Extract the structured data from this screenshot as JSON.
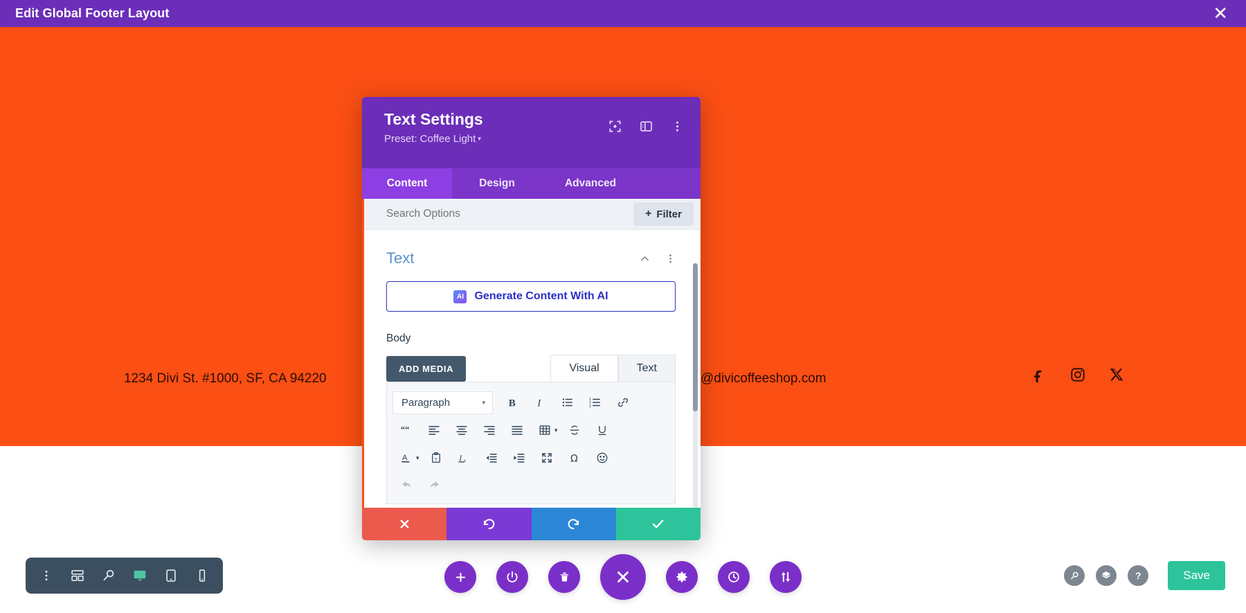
{
  "topbar": {
    "title": "Edit Global Footer Layout",
    "close_icon": "close-icon",
    "close_glyph": "✕",
    "background": "#6c2eb9"
  },
  "footer": {
    "background": "#fb4f14",
    "address": "1234 Divi St. #1000, SF, CA 94220",
    "email": "@divicoffeeshop.com",
    "social": [
      {
        "name": "facebook-icon",
        "label": "Facebook"
      },
      {
        "name": "instagram-icon",
        "label": "Instagram"
      },
      {
        "name": "x-twitter-icon",
        "label": "X"
      }
    ]
  },
  "modal": {
    "title": "Text Settings",
    "preset_label": "Preset: Coffee Light",
    "preset_caret": "▾",
    "header_icons": [
      {
        "name": "focus-target-icon"
      },
      {
        "name": "layout-panel-icon"
      },
      {
        "name": "more-vertical-icon"
      }
    ],
    "tabs": [
      {
        "label": "Content",
        "active": true
      },
      {
        "label": "Design",
        "active": false
      },
      {
        "label": "Advanced",
        "active": false
      }
    ],
    "search": {
      "placeholder": "Search Options",
      "value": ""
    },
    "filter": {
      "label": "Filter",
      "plus": "+"
    },
    "section": {
      "title": "Text",
      "collapse_icon": "chevron-up-icon",
      "menu_icon": "more-vertical-icon"
    },
    "ai_button": {
      "label": "Generate Content With AI",
      "badge": "AI"
    },
    "body_field": {
      "label": "Body",
      "add_media": "ADD MEDIA",
      "editor_tabs": [
        {
          "label": "Visual",
          "active": true
        },
        {
          "label": "Text",
          "active": false
        }
      ],
      "format_select": {
        "value": "Paragraph",
        "caret": "▾"
      },
      "toolbar_rows": [
        [
          {
            "name": "bold-icon"
          },
          {
            "name": "italic-icon"
          },
          {
            "name": "bulleted-list-icon"
          },
          {
            "name": "numbered-list-icon"
          },
          {
            "name": "link-icon"
          }
        ],
        [
          {
            "name": "blockquote-icon"
          },
          {
            "name": "align-left-icon"
          },
          {
            "name": "align-center-icon"
          },
          {
            "name": "align-right-icon"
          },
          {
            "name": "align-justify-icon"
          },
          {
            "name": "table-icon"
          },
          {
            "name": "strikethrough-icon"
          },
          {
            "name": "underline-icon"
          }
        ],
        [
          {
            "name": "text-color-icon"
          },
          {
            "name": "paste-as-text-icon"
          },
          {
            "name": "clear-formatting-icon"
          },
          {
            "name": "outdent-icon"
          },
          {
            "name": "indent-icon"
          },
          {
            "name": "fullscreen-icon"
          },
          {
            "name": "special-character-icon"
          },
          {
            "name": "emoji-icon"
          }
        ],
        [
          {
            "name": "undo-icon"
          },
          {
            "name": "redo-icon"
          }
        ]
      ]
    },
    "footer_actions": [
      {
        "name": "cancel-button",
        "icon": "close-icon",
        "color": "#eb5a4d"
      },
      {
        "name": "undo-button",
        "icon": "undo-icon",
        "color": "#7b3ad6"
      },
      {
        "name": "redo-button",
        "icon": "redo-icon",
        "color": "#2b87d6"
      },
      {
        "name": "save-button",
        "icon": "check-icon",
        "color": "#2dc49b"
      }
    ]
  },
  "bottom_bar": {
    "left_dock": [
      {
        "name": "more-vertical-icon"
      },
      {
        "name": "wireframe-icon"
      },
      {
        "name": "zoom-out-icon"
      },
      {
        "name": "desktop-view-icon",
        "active": true
      },
      {
        "name": "tablet-view-icon"
      },
      {
        "name": "phone-view-icon"
      }
    ],
    "center_dock": [
      {
        "name": "add-icon"
      },
      {
        "name": "power-icon"
      },
      {
        "name": "trash-icon"
      },
      {
        "name": "close-menu-icon",
        "big": true
      },
      {
        "name": "settings-gear-icon"
      },
      {
        "name": "history-clock-icon"
      },
      {
        "name": "sort-updown-icon"
      }
    ],
    "right_dock": [
      {
        "name": "zoom-out-icon"
      },
      {
        "name": "layers-icon"
      },
      {
        "name": "help-icon",
        "glyph": "?"
      }
    ],
    "save_label": "Save",
    "save_color": "#2dc49b"
  }
}
